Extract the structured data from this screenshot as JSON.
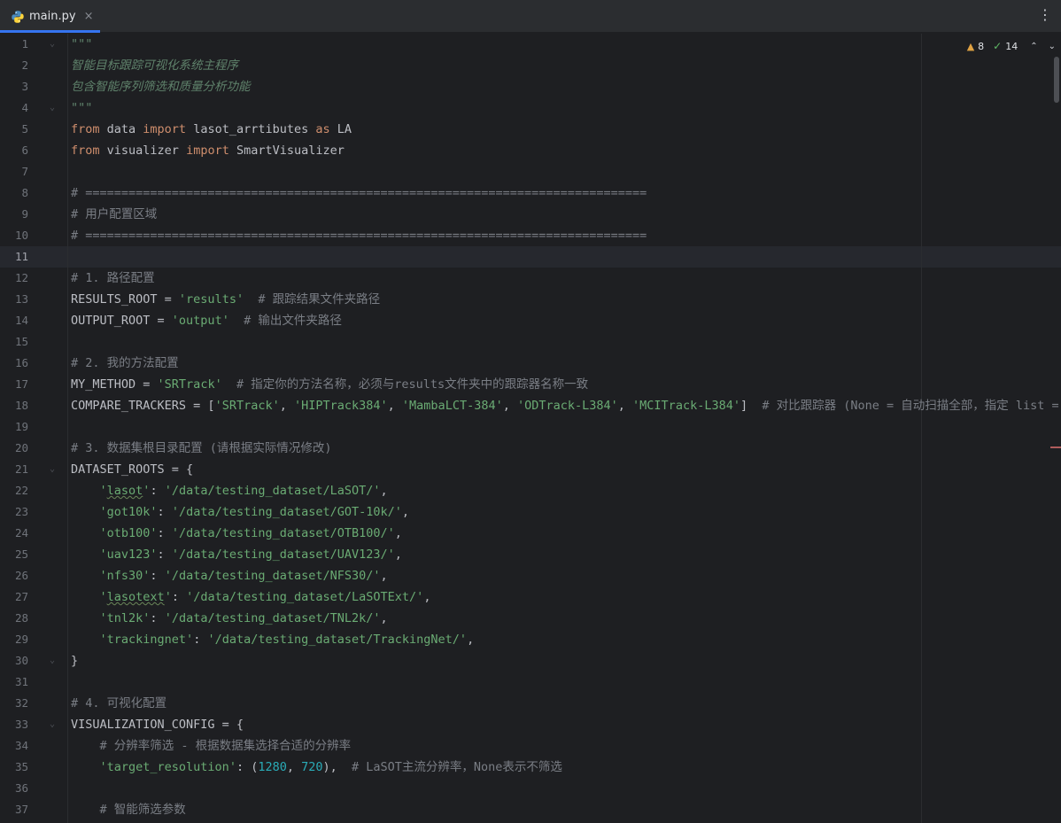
{
  "tab": {
    "filename": "main.py",
    "close_glyph": "×"
  },
  "toolbar": {
    "menu_glyph": "⋮"
  },
  "inspections": {
    "warnings": "8",
    "checks": "14"
  },
  "current_line": 11,
  "lines": [
    {
      "n": "1",
      "t": "\"\"\""
    },
    {
      "n": "2",
      "t": "智能目标跟踪可视化系统主程序"
    },
    {
      "n": "3",
      "t": "包含智能序列筛选和质量分析功能"
    },
    {
      "n": "4",
      "t": "\"\"\""
    },
    {
      "n": "5",
      "t": "from data import lasot_arrtibutes as LA"
    },
    {
      "n": "6",
      "t": "from visualizer import SmartVisualizer"
    },
    {
      "n": "7",
      "t": ""
    },
    {
      "n": "8",
      "t": "# =============================================================================="
    },
    {
      "n": "9",
      "t": "# 用户配置区域"
    },
    {
      "n": "10",
      "t": "# =============================================================================="
    },
    {
      "n": "11",
      "t": ""
    },
    {
      "n": "12",
      "t": "# 1. 路径配置"
    },
    {
      "n": "13",
      "t": "RESULTS_ROOT = 'results'  # 跟踪结果文件夹路径"
    },
    {
      "n": "14",
      "t": "OUTPUT_ROOT = 'output'  # 输出文件夹路径"
    },
    {
      "n": "15",
      "t": ""
    },
    {
      "n": "16",
      "t": "# 2. 我的方法配置"
    },
    {
      "n": "17",
      "t": "MY_METHOD = 'SRTrack'  # 指定你的方法名称，必须与results文件夹中的跟踪器名称一致"
    },
    {
      "n": "18",
      "t": "COMPARE_TRACKERS = ['SRTrack', 'HIPTrack384', 'MambaLCT-384', 'ODTrack-L384', 'MCITrack-L384']  # 对比跟踪器 (None = 自动扫描全部，指定 list = 只"
    },
    {
      "n": "19",
      "t": ""
    },
    {
      "n": "20",
      "t": "# 3. 数据集根目录配置 (请根据实际情况修改)"
    },
    {
      "n": "21",
      "t": "DATASET_ROOTS = {"
    },
    {
      "n": "22",
      "t": "    'lasot': '/data/testing_dataset/LaSOT/',"
    },
    {
      "n": "23",
      "t": "    'got10k': '/data/testing_dataset/GOT-10k/',"
    },
    {
      "n": "24",
      "t": "    'otb100': '/data/testing_dataset/OTB100/',"
    },
    {
      "n": "25",
      "t": "    'uav123': '/data/testing_dataset/UAV123/',"
    },
    {
      "n": "26",
      "t": "    'nfs30': '/data/testing_dataset/NFS30/',"
    },
    {
      "n": "27",
      "t": "    'lasotext': '/data/testing_dataset/LaSOTExt/',"
    },
    {
      "n": "28",
      "t": "    'tnl2k': '/data/testing_dataset/TNL2k/',"
    },
    {
      "n": "29",
      "t": "    'trackingnet': '/data/testing_dataset/TrackingNet/',"
    },
    {
      "n": "30",
      "t": "}"
    },
    {
      "n": "31",
      "t": ""
    },
    {
      "n": "32",
      "t": "# 4. 可视化配置"
    },
    {
      "n": "33",
      "t": "VISUALIZATION_CONFIG = {"
    },
    {
      "n": "34",
      "t": "    # 分辨率筛选 - 根据数据集选择合适的分辨率"
    },
    {
      "n": "35",
      "t": "    'target_resolution': (1280, 720),  # LaSOT主流分辨率，None表示不筛选"
    },
    {
      "n": "36",
      "t": ""
    },
    {
      "n": "37",
      "t": "    # 智能筛选参数"
    }
  ]
}
